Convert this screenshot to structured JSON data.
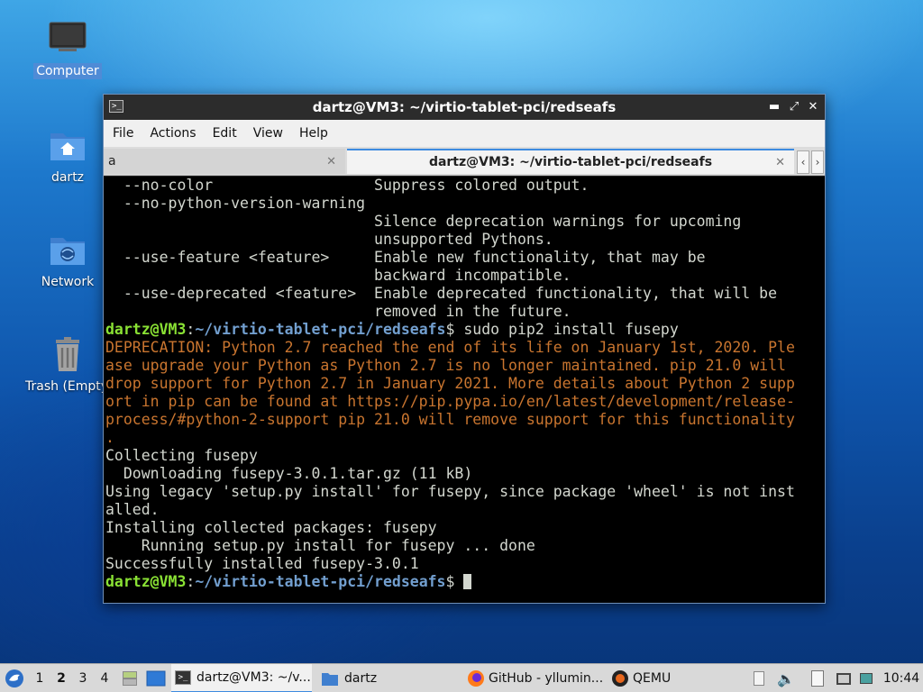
{
  "desktop": {
    "icons": [
      {
        "label": "Computer"
      },
      {
        "label": "dartz"
      },
      {
        "label": "Network"
      },
      {
        "label": "Trash (Empty)"
      }
    ]
  },
  "window": {
    "title": "dartz@VM3: ~/virtio-tablet-pci/redseafs",
    "menu": [
      "File",
      "Actions",
      "Edit",
      "View",
      "Help"
    ],
    "tabs": [
      {
        "label": "a",
        "active": false
      },
      {
        "label": "dartz@VM3: ~/virtio-tablet-pci/redseafs",
        "active": true
      }
    ]
  },
  "terminal": {
    "prompt_user": "dartz@VM3",
    "prompt_path": "~/virtio-tablet-pci/redseafs",
    "lines": [
      {
        "type": "out",
        "text": "  --no-color                  Suppress colored output."
      },
      {
        "type": "out",
        "text": "  --no-python-version-warning"
      },
      {
        "type": "out",
        "text": "                              Silence deprecation warnings for upcoming"
      },
      {
        "type": "out",
        "text": "                              unsupported Pythons."
      },
      {
        "type": "out",
        "text": "  --use-feature <feature>     Enable new functionality, that may be"
      },
      {
        "type": "out",
        "text": "                              backward incompatible."
      },
      {
        "type": "out",
        "text": "  --use-deprecated <feature>  Enable deprecated functionality, that will be"
      },
      {
        "type": "out",
        "text": "                              removed in the future."
      },
      {
        "type": "prompt",
        "text": "$ sudo pip2 install fusepy"
      },
      {
        "type": "warn",
        "text": "DEPRECATION: Python 2.7 reached the end of its life on January 1st, 2020. Ple"
      },
      {
        "type": "warn",
        "text": "ase upgrade your Python as Python 2.7 is no longer maintained. pip 21.0 will"
      },
      {
        "type": "warn",
        "text": "drop support for Python 2.7 in January 2021. More details about Python 2 supp"
      },
      {
        "type": "warn",
        "text": "ort in pip can be found at https://pip.pypa.io/en/latest/development/release-"
      },
      {
        "type": "warn",
        "text": "process/#python-2-support pip 21.0 will remove support for this functionality"
      },
      {
        "type": "warn",
        "text": "."
      },
      {
        "type": "out",
        "text": "Collecting fusepy"
      },
      {
        "type": "out",
        "text": "  Downloading fusepy-3.0.1.tar.gz (11 kB)"
      },
      {
        "type": "out",
        "text": "Using legacy 'setup.py install' for fusepy, since package 'wheel' is not inst"
      },
      {
        "type": "out",
        "text": "alled."
      },
      {
        "type": "out",
        "text": "Installing collected packages: fusepy"
      },
      {
        "type": "out",
        "text": "    Running setup.py install for fusepy ... done"
      },
      {
        "type": "out",
        "text": "Successfully installed fusepy-3.0.1"
      },
      {
        "type": "prompt",
        "text": "$ "
      }
    ]
  },
  "taskbar": {
    "workspaces": [
      "1",
      "2",
      "3",
      "4"
    ],
    "current_workspace": "2",
    "tasks": [
      {
        "label": "dartz@VM3: ~/v..."
      },
      {
        "label": "dartz"
      },
      {
        "label": "GitHub - yllumin..."
      },
      {
        "label": "QEMU"
      }
    ],
    "clock": "10:44"
  }
}
